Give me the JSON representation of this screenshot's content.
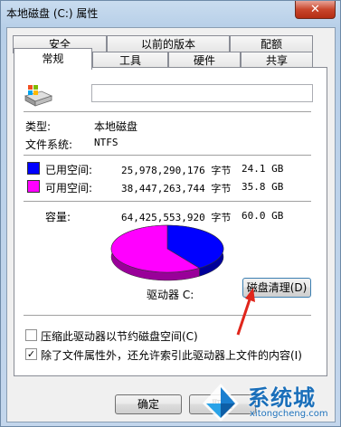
{
  "window": {
    "title": "本地磁盘 (C:) 属性",
    "close_symbol": "✕"
  },
  "tabs": {
    "row1": [
      "安全",
      "以前的版本",
      "配额"
    ],
    "row2": [
      "常规",
      "工具",
      "硬件",
      "共享"
    ],
    "active": "常规"
  },
  "general": {
    "drive_name_value": "",
    "type_label": "类型:",
    "type_value": "本地磁盘",
    "fs_label": "文件系统:",
    "fs_value": "NTFS",
    "used": {
      "label": "已用空间:",
      "bytes": "25,978,290,176 字节",
      "size": "24.1 GB",
      "color": "#0000ff"
    },
    "free": {
      "label": "可用空间:",
      "bytes": "38,447,263,744 字节",
      "size": "35.8 GB",
      "color": "#ff00ff"
    },
    "capacity": {
      "label": "容量:",
      "bytes": "64,425,553,920 字节",
      "size": "60.0 GB"
    },
    "drive_label": "驱动器 C:",
    "cleanup_button": "磁盘清理(D)",
    "compress_label": "压缩此驱动器以节约磁盘空间(C)",
    "compress_checked": false,
    "index_label": "除了文件属性外，还允许索引此驱动器上文件的内容(I)",
    "index_checked": true,
    "check_mark": "✓"
  },
  "buttons": {
    "ok": "确定",
    "cancel": "取消"
  },
  "watermark": {
    "brand": "系统城",
    "url": "xitongcheng.com"
  },
  "chart_data": {
    "type": "pie",
    "title": "",
    "slices": [
      {
        "name": "已用空间",
        "value": 25978290176,
        "color": "#0000ff"
      },
      {
        "name": "可用空间",
        "value": 38447263744,
        "color": "#ff00ff"
      }
    ]
  }
}
